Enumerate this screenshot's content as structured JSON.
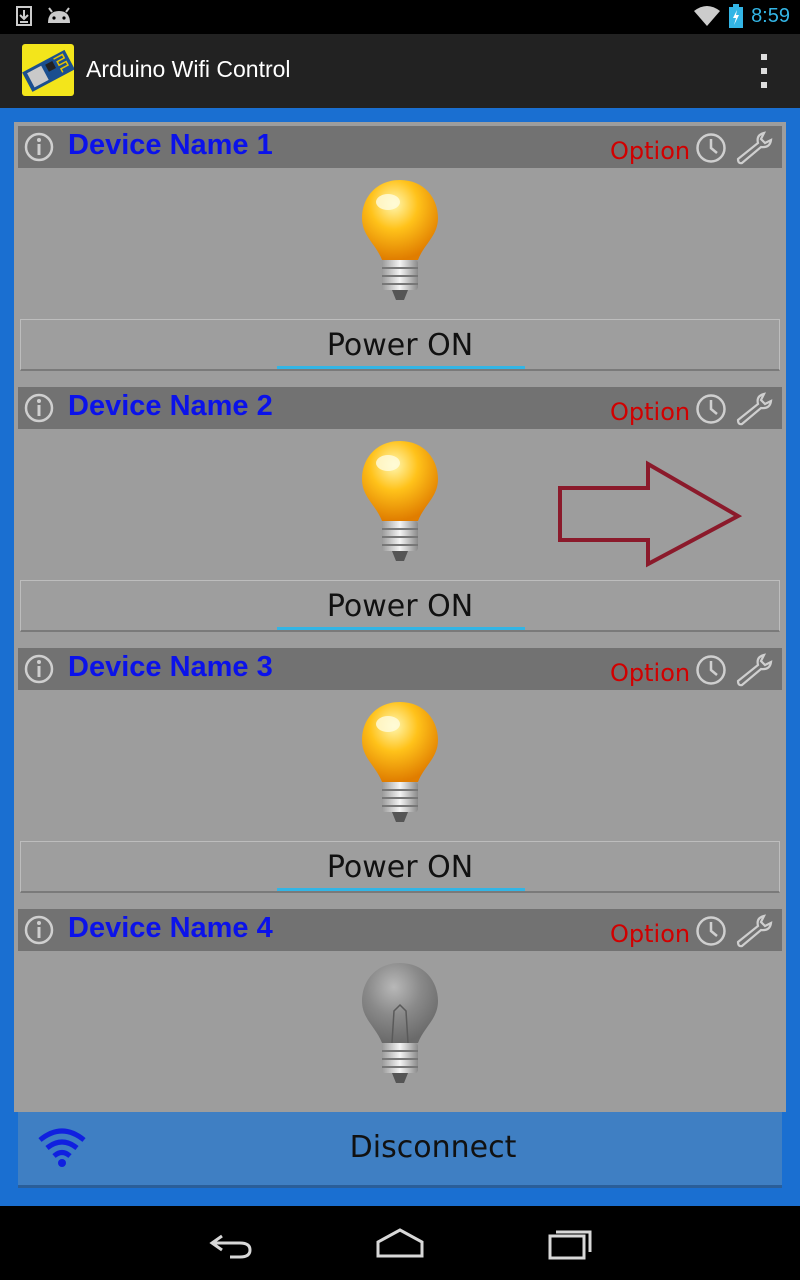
{
  "status_bar": {
    "time": "8:59",
    "left_icons": [
      "download-icon",
      "android-icon"
    ],
    "right_icons": [
      "wifi-signal-icon",
      "battery-charging-icon"
    ]
  },
  "app": {
    "title": "Arduino Wifi Control",
    "icon": "esp8266-module-icon",
    "menu_icon": "overflow-menu-icon"
  },
  "devices": [
    {
      "name": "Device Name 1",
      "option_label": "Option",
      "bulb_state": "on",
      "power_label": "Power ON",
      "show_power_button": true
    },
    {
      "name": "Device Name 2",
      "option_label": "Option",
      "bulb_state": "on",
      "power_label": "Power ON",
      "show_power_button": true
    },
    {
      "name": "Device Name 3",
      "option_label": "Option",
      "bulb_state": "on",
      "power_label": "Power ON",
      "show_power_button": true
    },
    {
      "name": "Device Name 4",
      "option_label": "Option",
      "bulb_state": "off",
      "power_label": "",
      "show_power_button": false
    }
  ],
  "disconnect": {
    "label": "Disconnect",
    "icon": "wifi-icon"
  },
  "nav_bar": {
    "buttons": [
      "back-icon",
      "home-icon",
      "recents-icon"
    ]
  },
  "colors": {
    "accent_blue": "#1a6fd1",
    "device_name": "#0b12ea",
    "option_text": "#d10000",
    "holo_blue": "#33b5e5",
    "annotation_arrow": "#8b1a2b"
  }
}
